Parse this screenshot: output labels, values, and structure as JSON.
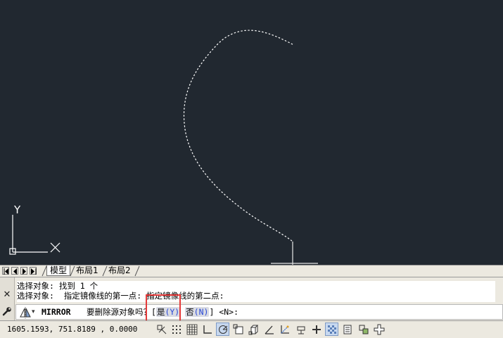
{
  "canvas": {
    "background": "#212830",
    "axis_y_label": "Y",
    "axis_x_label": "X"
  },
  "layout_tabs": {
    "model": "模型",
    "layout1": "布局1",
    "layout2": "布局2"
  },
  "command": {
    "history": [
      "选择对象: 找到 1 个",
      "选择对象:  指定镜像线的第一点: 指定镜像线的第二点:"
    ],
    "command_name": "MIRROR",
    "prompt": "要删除源对象吗？",
    "open_bracket": "[",
    "option_yes_label": "是",
    "option_yes_key": "(Y)",
    "option_no_label": "否",
    "option_no_key": "(N)",
    "close_bracket": "]",
    "default": "<N>:",
    "highlight_color": "#e53a3a"
  },
  "status": {
    "coordinates": "1605.1593, 751.8189 , 0.0000",
    "buttons": [
      {
        "name": "infer-constraints",
        "icon": "infer-icon",
        "on": false
      },
      {
        "name": "snap-mode",
        "icon": "snap-icon",
        "on": false
      },
      {
        "name": "grid-display",
        "icon": "grid-icon",
        "on": false
      },
      {
        "name": "ortho-mode",
        "icon": "ortho-icon",
        "on": false
      },
      {
        "name": "polar-tracking",
        "icon": "polar-icon",
        "on": true
      },
      {
        "name": "object-snap",
        "icon": "osnap-icon",
        "on": false
      },
      {
        "name": "3d-object-snap",
        "icon": "osnap3d-icon",
        "on": false
      },
      {
        "name": "object-snap-tracking",
        "icon": "otrack-icon",
        "on": false
      },
      {
        "name": "dynamic-ucs",
        "icon": "ducs-icon",
        "on": false
      },
      {
        "name": "dynamic-input",
        "icon": "dyn-icon",
        "on": false
      },
      {
        "name": "lineweight",
        "icon": "lineweight-icon",
        "on": false
      },
      {
        "name": "transparency",
        "icon": "transparency-icon",
        "on": false
      },
      {
        "name": "quick-properties",
        "icon": "qp-icon",
        "on": false
      },
      {
        "name": "selection-cycling",
        "icon": "selcycle-icon",
        "on": false
      },
      {
        "name": "annotation-monitor",
        "icon": "annomon-icon",
        "on": false
      }
    ]
  }
}
